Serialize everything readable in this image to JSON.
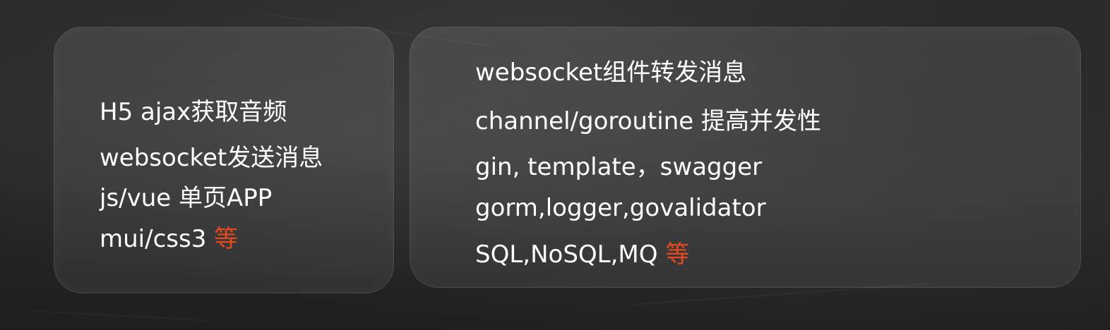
{
  "colors": {
    "background": "#262626",
    "text": "#ffffff",
    "accent": "#e8481f"
  },
  "left_panel": {
    "items": [
      {
        "text": "H5 ajax获取音频"
      },
      {
        "text": "websocket发送消息"
      },
      {
        "text": "js/vue 单页APP"
      },
      {
        "text": "mui/css3 ",
        "accent": "等"
      }
    ]
  },
  "right_panel": {
    "items": [
      {
        "text": "websocket组件转发消息"
      },
      {
        "text": "channel/goroutine 提高并发性"
      },
      {
        "text": "gin, template，swagger"
      },
      {
        "text": "gorm,logger,govalidator"
      },
      {
        "text": "SQL,NoSQL,MQ ",
        "accent": "等"
      }
    ]
  }
}
